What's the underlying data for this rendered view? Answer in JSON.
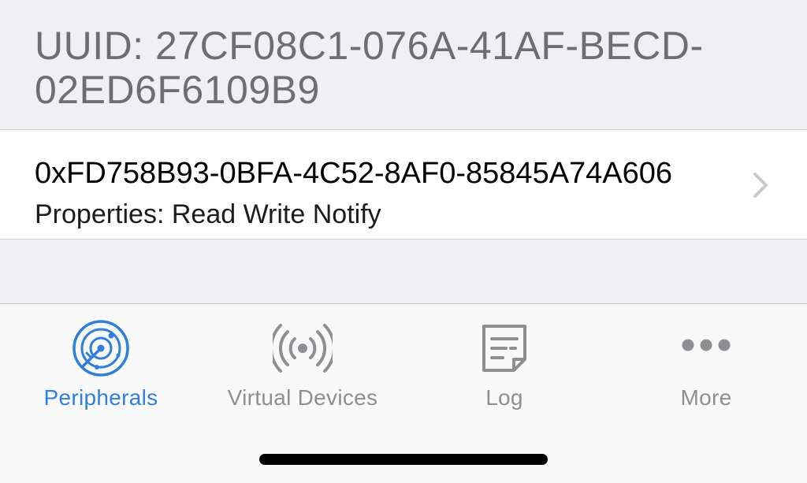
{
  "service": {
    "title": "UUID: 27CF08C1-076A-41AF-BECD-02ED6F6109B9"
  },
  "characteristic": {
    "uuid": "0xFD758B93-0BFA-4C52-8AF0-85845A74A606",
    "properties": "Properties: Read Write Notify"
  },
  "tabbar": {
    "tabs": [
      {
        "label": "Peripherals",
        "icon": "radar-icon",
        "active": true
      },
      {
        "label": "Virtual Devices",
        "icon": "broadcast-icon",
        "active": false
      },
      {
        "label": "Log",
        "icon": "log-note-icon",
        "active": false
      },
      {
        "label": "More",
        "icon": "more-dots-icon",
        "active": false
      }
    ]
  },
  "colors": {
    "accent": "#2f7fdb",
    "inactive": "#8e8e93",
    "grouped_background": "#efeff4"
  }
}
